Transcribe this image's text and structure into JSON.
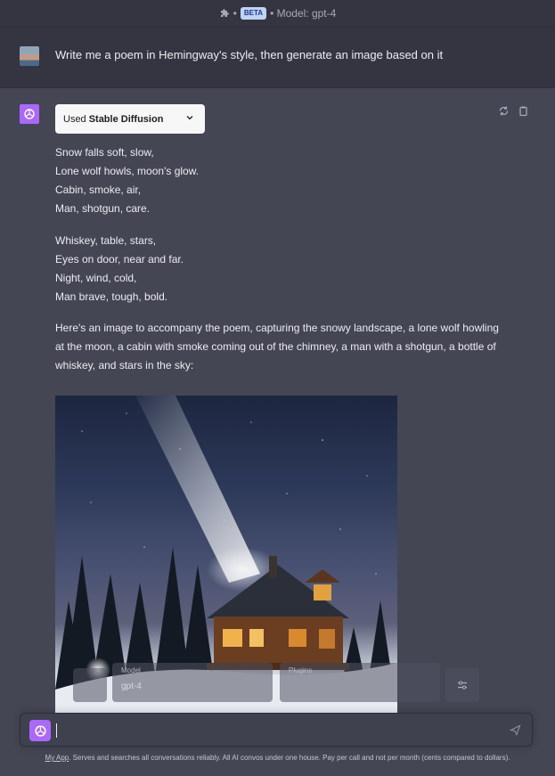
{
  "topbar": {
    "plugins_icon": "puzzle-icon",
    "beta_label": "BETA",
    "model_label": "• Model: gpt-4"
  },
  "user_message": {
    "text": "Write me a poem in Hemingway's style, then generate an image based on it"
  },
  "assistant": {
    "used_prefix": "Used",
    "used_plugin": "Stable Diffusion",
    "poem_stanza_1": [
      "Snow falls soft, slow,",
      "Lone wolf howls, moon's glow.",
      "Cabin, smoke, air,",
      "Man, shotgun, care."
    ],
    "poem_stanza_2": [
      "Whiskey, table, stars,",
      "Eyes on door, near and far.",
      "Night, wind, cold,",
      "Man brave, tough, bold."
    ],
    "intro": "Here's an image to accompany the poem, capturing the snowy landscape, a lone wolf howling at the moon, a cabin with smoke coming out of the chimney, a man with a shotgun, a bottle of whiskey, and stars in the sky:"
  },
  "overlay": {
    "model_label": "Model",
    "model_value": "gpt-4",
    "plugins_label": "Plugins"
  },
  "composer": {
    "value": ""
  },
  "footer": {
    "link": "My App",
    "text": ". Serves and searches all conversations reliably. All AI convos under one house. Pay per call and not per month (cents compared to dollars)."
  },
  "colors": {
    "accent": "#ab68ff",
    "background": "#444654",
    "header": "#343541"
  }
}
